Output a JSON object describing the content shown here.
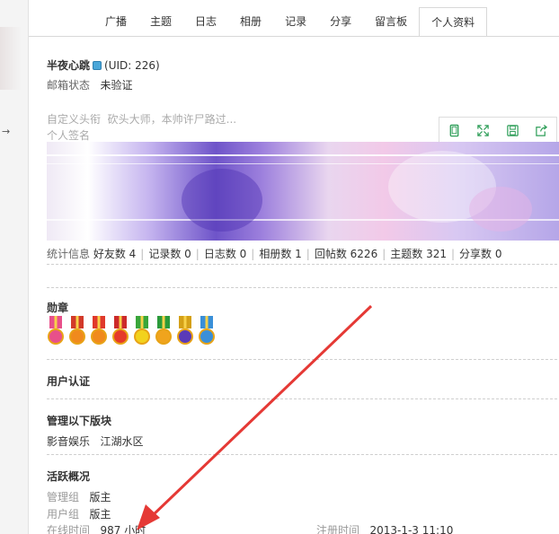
{
  "tabs": [
    "广播",
    "主题",
    "日志",
    "相册",
    "记录",
    "分享",
    "留言板",
    "个人资料"
  ],
  "active_tab": "个人资料",
  "profile": {
    "username": "半夜心跳",
    "uid": "(UID: 226)",
    "email_label": "邮箱状态",
    "email_value": "未验证",
    "custom_title_label": "自定义头衔",
    "custom_title_value": "砍头大师，本帅许尸路过...",
    "signature_label": "个人签名"
  },
  "toolbar_icons": [
    "tablet-icon",
    "fullscreen-icon",
    "save-icon",
    "share-icon"
  ],
  "stats": {
    "label": "统计信息",
    "items": [
      "好友数 4",
      "记录数 0",
      "日志数 0",
      "相册数 1",
      "回帖数 6226",
      "主题数 321",
      "分享数 0"
    ]
  },
  "medals_title": "勋章",
  "medals": [
    {
      "ribbon": "#e8508a",
      "disc": "#e8508a"
    },
    {
      "ribbon": "#d23a2a",
      "disc": "#f08a1d"
    },
    {
      "ribbon": "#e0392c",
      "disc": "#f08a1d"
    },
    {
      "ribbon": "#cc2a2a",
      "disc": "#e53a2a"
    },
    {
      "ribbon": "#3aa63a",
      "disc": "#f2d21d"
    },
    {
      "ribbon": "#2b9a3a",
      "disc": "#f0a41d"
    },
    {
      "ribbon": "#d4a017",
      "disc": "#5a3ab8"
    },
    {
      "ribbon": "#3a8fd8",
      "disc": "#3a8fd8"
    }
  ],
  "certification_title": "用户认证",
  "managed_title": "管理以下版块",
  "managed_forums": [
    "影音娱乐",
    "江湖水区"
  ],
  "activity": {
    "title": "活跃概况",
    "admin_group_label": "管理组",
    "admin_group_value": "版主",
    "user_group_label": "用户组",
    "user_group_value": "版主",
    "online_label": "在线时间",
    "online_value": "987 小时",
    "register_label": "注册时间",
    "register_value": "2013-1-3 11:10"
  },
  "colors": {
    "border": "#d8d8d8",
    "toolbar_icon": "#2e9e58",
    "annotation_arrow": "#e53935"
  }
}
